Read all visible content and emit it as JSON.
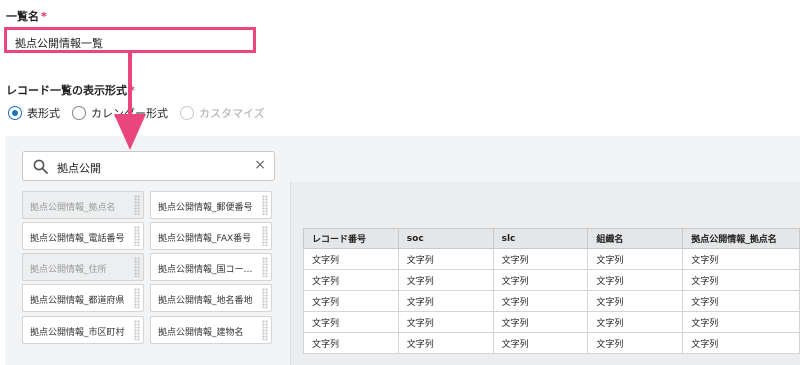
{
  "list_name": {
    "label": "一覧名",
    "required_mark": "*",
    "value": "拠点公開情報一覧"
  },
  "display_format": {
    "label": "レコード一覧の表示形式",
    "required_mark": "*",
    "options": [
      "表形式",
      "カレンダー形式",
      "カスタマイズ"
    ],
    "selected": "表形式",
    "disabled_option": "カスタマイズ"
  },
  "field_search": {
    "value": "拠点公開",
    "clear_glyph": "×"
  },
  "fields": [
    {
      "label": "拠点公開情報_拠点名",
      "used": true
    },
    {
      "label": "拠点公開情報_郵便番号",
      "used": false
    },
    {
      "label": "拠点公開情報_電話番号",
      "used": false
    },
    {
      "label": "拠点公開情報_FAX番号",
      "used": false
    },
    {
      "label": "拠点公開情報_住所",
      "used": true
    },
    {
      "label": "拠点公開情報_国コード…",
      "used": false
    },
    {
      "label": "拠点公開情報_都道府県",
      "used": false
    },
    {
      "label": "拠点公開情報_地名番地",
      "used": false
    },
    {
      "label": "拠点公開情報_市区町村",
      "used": false
    },
    {
      "label": "拠点公開情報_建物名",
      "used": false
    }
  ],
  "preview_table": {
    "headers": [
      "レコード番号",
      "soc",
      "slc",
      "組織名",
      "拠点公開情報_拠点名"
    ],
    "rows": [
      [
        "文字列",
        "文字列",
        "文字列",
        "文字列",
        "文字列"
      ],
      [
        "文字列",
        "文字列",
        "文字列",
        "文字列",
        "文字列"
      ],
      [
        "文字列",
        "文字列",
        "文字列",
        "文字列",
        "文字列"
      ],
      [
        "文字列",
        "文字列",
        "文字列",
        "文字列",
        "文字列"
      ],
      [
        "文字列",
        "文字列",
        "文字列",
        "文字列",
        "文字列"
      ]
    ]
  },
  "colors": {
    "highlight": "#e8467c",
    "radio_selected": "#1a73c8"
  },
  "icons": [
    "search-icon",
    "clear-icon",
    "drag-grip-icon",
    "callout-arrow"
  ]
}
